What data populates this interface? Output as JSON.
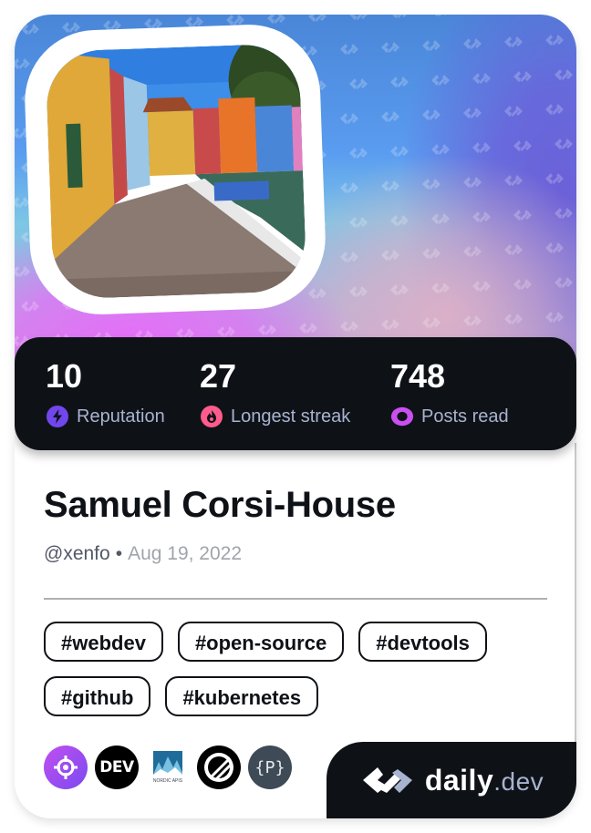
{
  "profile": {
    "name": "Samuel Corsi-House",
    "username": "@xenfo",
    "separator": "•",
    "joined": "Aug 19, 2022",
    "avatar_description": "Colorful canal street photo (Burano, Venice)"
  },
  "stats": [
    {
      "value": "10",
      "label": "Reputation",
      "icon": "lightning-icon",
      "color": "#7147ed"
    },
    {
      "value": "27",
      "label": "Longest streak",
      "icon": "flame-icon",
      "color": "#ff5b8c"
    },
    {
      "value": "748",
      "label": "Posts read",
      "icon": "eye-ring-icon",
      "color": "#c94ff0"
    }
  ],
  "tags": [
    "#webdev",
    "#open-source",
    "#devtools",
    "#github",
    "#kubernetes"
  ],
  "sources": [
    {
      "name": "crosshair-source",
      "bg": "#a855f7"
    },
    {
      "name": "dev-to-source",
      "label": "DEV",
      "bg": "#000000"
    },
    {
      "name": "nordic-apis-source",
      "label": "NORDIC APIS"
    },
    {
      "name": "slashed-circle-source",
      "bg": "#000000"
    },
    {
      "name": "p-braces-source",
      "label": "{P}",
      "bg": "#3e4a56"
    }
  ],
  "brand": {
    "name": "daily",
    "tld": ".dev"
  },
  "colors": {
    "dark": "#0e1217",
    "label": "#a8b3cf",
    "muted": "#a0a4ab"
  }
}
